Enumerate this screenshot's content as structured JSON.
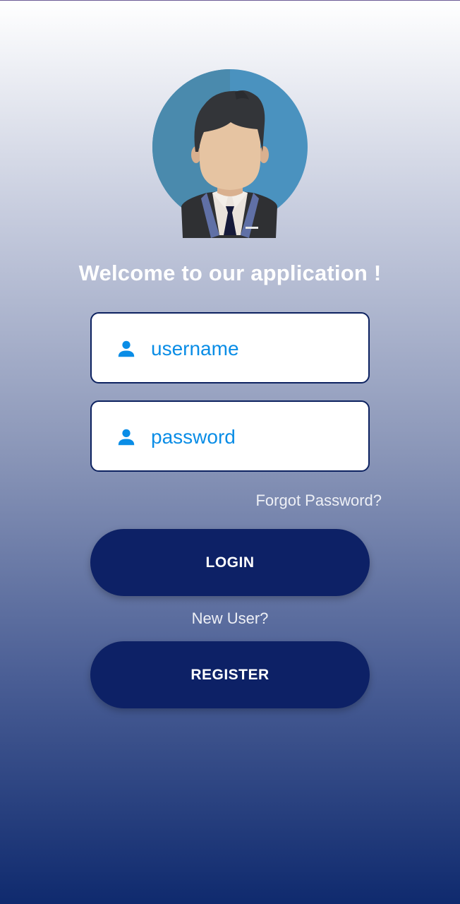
{
  "header": {
    "welcome_text": "Welcome to our application !"
  },
  "form": {
    "username": {
      "placeholder": "username",
      "value": "",
      "icon": "person-icon"
    },
    "password": {
      "placeholder": "password",
      "value": "",
      "icon": "person-icon"
    },
    "forgot_password_label": "Forgot Password?",
    "login_label": "LOGIN",
    "new_user_label": "New User?",
    "register_label": "REGISTER"
  },
  "colors": {
    "accent": "#0a8de6",
    "button": "#0d2166",
    "field_border": "#0d2260",
    "gradient_top": "#ffffff",
    "gradient_bottom": "#0f2a6e"
  }
}
